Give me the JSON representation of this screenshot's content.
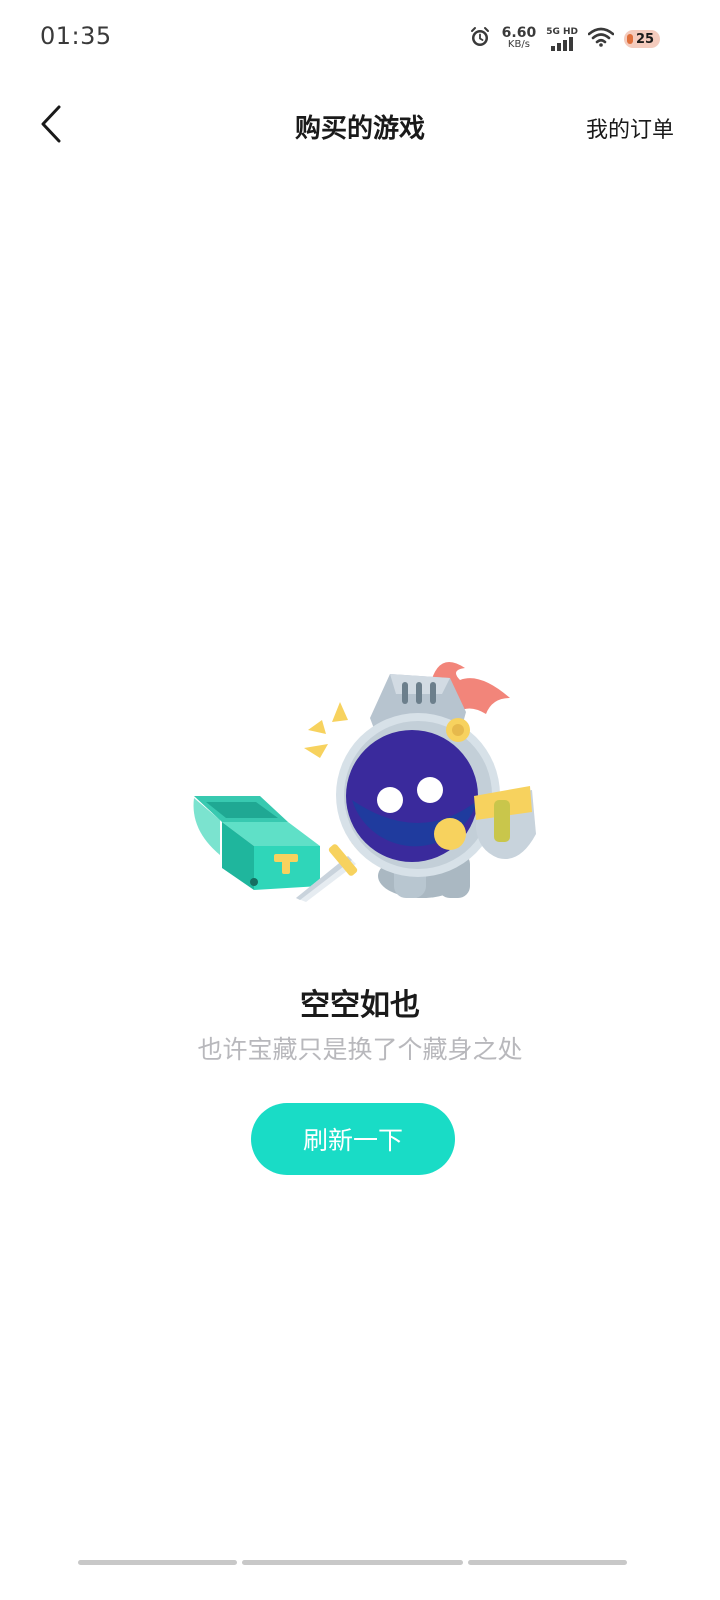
{
  "status_bar": {
    "time": "01:35",
    "net_speed_value": "6.60",
    "net_speed_unit": "KB/s",
    "network_label": "5G HD",
    "battery_level": "25",
    "icons": [
      "alarm-icon",
      "signal-icon",
      "wifi-icon",
      "battery-icon"
    ]
  },
  "header": {
    "title": "购买的游戏",
    "orders_link": "我的订单",
    "back_icon": "chevron-left-icon"
  },
  "empty_state": {
    "title": "空空如也",
    "subtitle": "也许宝藏只是换了个藏身之处",
    "refresh_label": "刷新一下",
    "illustration": "knight-with-treasure-chest"
  },
  "colors": {
    "accent": "#19dcc6",
    "subtitle_gray": "#b8b8bc",
    "text_dark": "#1a1a1a"
  }
}
